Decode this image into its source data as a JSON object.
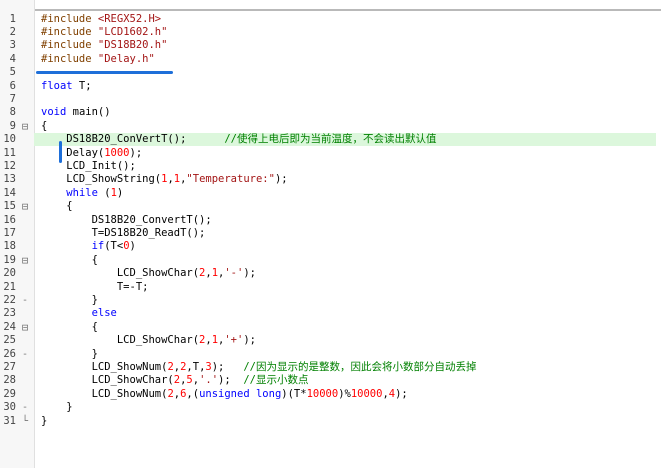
{
  "editor": {
    "lines": [
      {
        "num": "1",
        "fold": "",
        "text": "#include <REGX52.H>",
        "type": "pp"
      },
      {
        "num": "2",
        "fold": "",
        "text": "#include \"LCD1602.h\"",
        "type": "pp"
      },
      {
        "num": "3",
        "fold": "",
        "text": "#include \"DS18B20.h\"",
        "type": "pp"
      },
      {
        "num": "4",
        "fold": "",
        "text": "#include \"Delay.h\"",
        "type": "pp"
      },
      {
        "num": "5",
        "fold": "",
        "text": "",
        "type": "plain"
      },
      {
        "num": "6",
        "fold": "",
        "text": "float T;",
        "type": "plain"
      },
      {
        "num": "7",
        "fold": "",
        "text": "",
        "type": "plain"
      },
      {
        "num": "8",
        "fold": "",
        "text": "void main()",
        "type": "plain"
      },
      {
        "num": "9",
        "fold": "⊟",
        "text": "{",
        "type": "plain"
      },
      {
        "num": "10",
        "fold": "",
        "text": "    DS18B20_ConVertT();      //使得上电后即为当前温度，不会读出默认值",
        "type": "plain",
        "highlight": true
      },
      {
        "num": "11",
        "fold": "",
        "text": "    Delay(1000);",
        "type": "plain"
      },
      {
        "num": "12",
        "fold": "",
        "text": "    LCD_Init();",
        "type": "plain"
      },
      {
        "num": "13",
        "fold": "",
        "text": "    LCD_ShowString(1,1,\"Temperature:\");",
        "type": "plain"
      },
      {
        "num": "14",
        "fold": "",
        "text": "    while (1)",
        "type": "plain"
      },
      {
        "num": "15",
        "fold": "⊟",
        "text": "    {",
        "type": "plain"
      },
      {
        "num": "16",
        "fold": "",
        "text": "        DS18B20_ConvertT();",
        "type": "plain"
      },
      {
        "num": "17",
        "fold": "",
        "text": "        T=DS18B20_ReadT();",
        "type": "plain"
      },
      {
        "num": "18",
        "fold": "",
        "text": "        if(T<0)",
        "type": "plain"
      },
      {
        "num": "19",
        "fold": "⊟",
        "text": "        {",
        "type": "plain"
      },
      {
        "num": "20",
        "fold": "",
        "text": "            LCD_ShowChar(2,1,'-');",
        "type": "plain"
      },
      {
        "num": "21",
        "fold": "",
        "text": "            T=-T;",
        "type": "plain"
      },
      {
        "num": "22",
        "fold": "-",
        "text": "        }",
        "type": "plain"
      },
      {
        "num": "23",
        "fold": "",
        "text": "        else",
        "type": "plain"
      },
      {
        "num": "24",
        "fold": "⊟",
        "text": "        {",
        "type": "plain"
      },
      {
        "num": "25",
        "fold": "",
        "text": "            LCD_ShowChar(2,1,'+');",
        "type": "plain"
      },
      {
        "num": "26",
        "fold": "-",
        "text": "        }",
        "type": "plain"
      },
      {
        "num": "27",
        "fold": "",
        "text": "        LCD_ShowNum(2,2,T,3);   //因为显示的是整数，因此会将小数部分自动丢掉",
        "type": "plain"
      },
      {
        "num": "28",
        "fold": "",
        "text": "        LCD_ShowChar(2,5,'.');  //显示小数点",
        "type": "plain"
      },
      {
        "num": "29",
        "fold": "",
        "text": "        LCD_ShowNum(2,6,(unsigned long)(T*10000)%10000,4);",
        "type": "plain"
      },
      {
        "num": "30",
        "fold": "-",
        "text": "    }",
        "type": "plain"
      },
      {
        "num": "31",
        "fold": "└",
        "text": "}",
        "type": "plain"
      }
    ]
  },
  "colors": {
    "keyword": "#0000ff",
    "number": "#ff0000",
    "string": "#a31515",
    "preprocessor": "#804000",
    "comment": "#008000",
    "highlight": "#dcf7dc",
    "annotation": "#1e6fd9"
  }
}
